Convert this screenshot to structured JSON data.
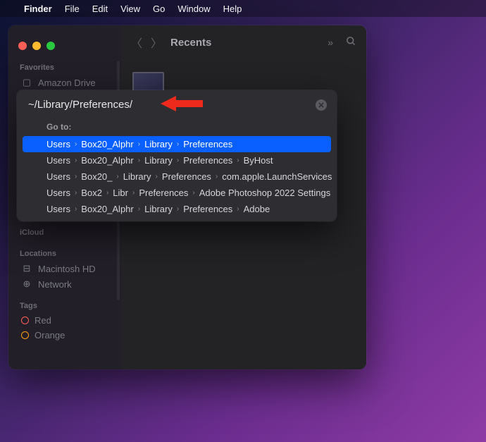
{
  "menubar": {
    "items": [
      "Finder",
      "File",
      "Edit",
      "View",
      "Go",
      "Window",
      "Help"
    ]
  },
  "window": {
    "title": "Recents"
  },
  "sidebar": {
    "sections": {
      "favorites": "Favorites",
      "icloud": "iCloud",
      "locations": "Locations",
      "tags": "Tags"
    },
    "favorites": [
      {
        "icon": "folder",
        "label": "Amazon Drive"
      }
    ],
    "locations": [
      {
        "icon": "disk",
        "label": "Macintosh HD"
      },
      {
        "icon": "globe",
        "label": "Network"
      }
    ],
    "tags": [
      {
        "color": "#ff6059",
        "label": "Red"
      },
      {
        "color": "#ff9f0a",
        "label": "Orange"
      }
    ]
  },
  "goto": {
    "input": "~/Library/Preferences/",
    "label": "Go to:",
    "results": [
      {
        "segments": [
          "Users",
          "Box20_Alphr",
          "Library",
          "Preferences"
        ],
        "selected": true
      },
      {
        "segments": [
          "Users",
          "Box20_Alphr",
          "Library",
          "Preferences",
          "ByHost"
        ],
        "selected": false
      },
      {
        "segments": [
          "Users",
          "Box20_",
          "Library",
          "Preferences",
          "com.apple.LaunchServices"
        ],
        "selected": false
      },
      {
        "segments": [
          "Users",
          "Box2",
          "Libr",
          "Preferences",
          "Adobe Photoshop 2022 Settings"
        ],
        "selected": false
      },
      {
        "segments": [
          "Users",
          "Box20_Alphr",
          "Library",
          "Preferences",
          "Adobe"
        ],
        "selected": false
      }
    ]
  },
  "annotation": {
    "arrow_color": "#ed2a1c"
  }
}
